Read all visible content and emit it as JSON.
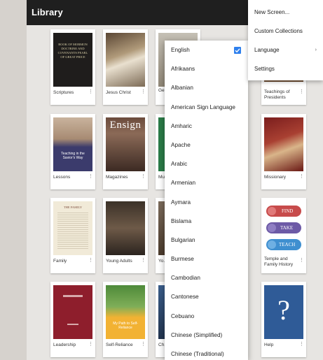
{
  "app": {
    "title": "Library"
  },
  "cards": [
    {
      "label": "Scriptures",
      "cover_text": "BOOK OF MORMON DOCTRINE AND COVENANTS PEARL OF GREAT PRICE"
    },
    {
      "label": "Jesus Christ"
    },
    {
      "label": "Ge... Co..."
    },
    {
      "label": "Teachings of Presidents"
    },
    {
      "label": "Lessons",
      "cover_text": "Teaching in the Savior's Way"
    },
    {
      "label": "Magazines",
      "cover_text": "Ensign"
    },
    {
      "label": "Mu..."
    },
    {
      "label": "Missionary"
    },
    {
      "label": "Family",
      "cover_text": "THE FAMILY"
    },
    {
      "label": "Young Adults"
    },
    {
      "label": "Yo..."
    },
    {
      "label": "Temple and Family History",
      "badges": [
        "FIND",
        "TAKE",
        "TEACH"
      ]
    },
    {
      "label": "Leadership"
    },
    {
      "label": "Self-Reliance",
      "cover_text": "My Path to Self-Reliance"
    },
    {
      "label": "Ch..."
    },
    {
      "label": "Help",
      "cover_text": "?"
    }
  ],
  "language_menu": {
    "selected": "English",
    "items": [
      "English",
      "Afrikaans",
      "Albanian",
      "American Sign Language",
      "Amharic",
      "Apache",
      "Arabic",
      "Armenian",
      "Aymara",
      "Bislama",
      "Bulgarian",
      "Burmese",
      "Cambodian",
      "Cantonese",
      "Cebuano",
      "Chinese (Simplified)",
      "Chinese (Traditional)"
    ]
  },
  "overflow_menu": {
    "items": [
      {
        "label": "New Screen..."
      },
      {
        "label": "Custom Collections"
      },
      {
        "label": "Language",
        "submenu_icon": "chevron-right-icon"
      },
      {
        "label": "Settings"
      }
    ]
  },
  "colors": {
    "appbar": "#1f1f1f",
    "check": "#2f80ed",
    "help": "#2f5b97",
    "leadership": "#8e1e2c"
  }
}
